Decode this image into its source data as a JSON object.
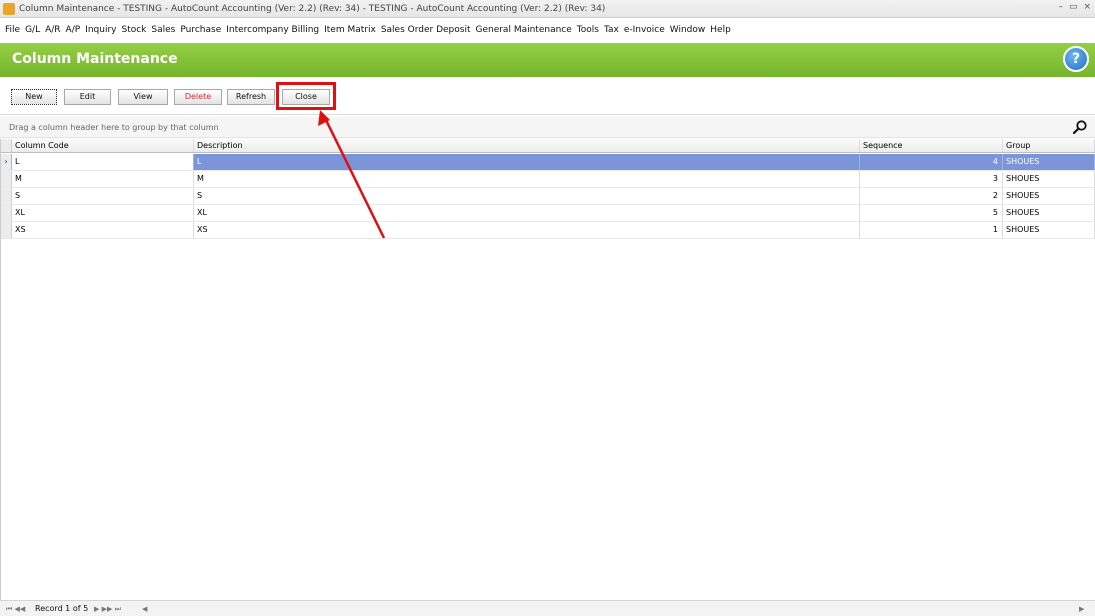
{
  "window": {
    "title": "Column Maintenance - TESTING - AutoCount Accounting (Ver: 2.2) (Rev: 34) - TESTING - AutoCount Accounting (Ver: 2.2) (Rev: 34)",
    "controls": [
      "–",
      "▭",
      "×"
    ]
  },
  "menu": [
    "File",
    "G/L",
    "A/R",
    "A/P",
    "Inquiry",
    "Stock",
    "Sales",
    "Purchase",
    "Intercompany Billing",
    "Item Matrix",
    "Sales Order Deposit",
    "General Maintenance",
    "Tools",
    "Tax",
    "e-Invoice",
    "Window",
    "Help"
  ],
  "header": {
    "title": "Column Maintenance",
    "help_glyph": "?"
  },
  "toolbar": {
    "new": "New",
    "edit": "Edit",
    "view": "View",
    "delete": "Delete",
    "refresh": "Refresh",
    "close": "Close"
  },
  "group_panel": {
    "hint": "Drag a column header here to group by that column"
  },
  "grid": {
    "columns": [
      "Column Code",
      "Description",
      "Sequence",
      "Group"
    ],
    "rows": [
      {
        "code": "L",
        "description": "L",
        "sequence": "4",
        "group": "SHOUES"
      },
      {
        "code": "M",
        "description": "M",
        "sequence": "3",
        "group": "SHOUES"
      },
      {
        "code": "S",
        "description": "S",
        "sequence": "2",
        "group": "SHOUES"
      },
      {
        "code": "XL",
        "description": "XL",
        "sequence": "5",
        "group": "SHOUES"
      },
      {
        "code": "XS",
        "description": "XS",
        "sequence": "1",
        "group": "SHOUES"
      }
    ],
    "selected_indicator": "›"
  },
  "status": {
    "nav_first": "⏮ ◀◀ ◀",
    "record": "Record 1 of 5",
    "nav_next": "▶ ▶▶ ⏭",
    "scroll_left": "◀",
    "scroll_right": "▶"
  },
  "colors": {
    "header_green": "#7ac034",
    "selected_row": "#7c95d8",
    "highlight_red": "#e01010",
    "delete_red": "#d12a2a"
  }
}
